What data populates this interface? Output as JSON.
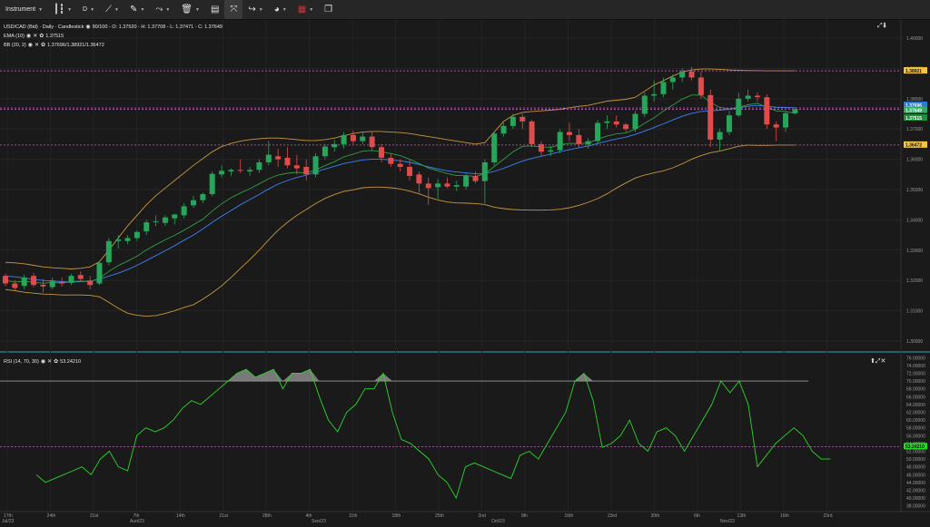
{
  "toolbar": {
    "instrument_label": "Instrument",
    "timeframe_label": "D",
    "items": [
      "candle-icon",
      "draw-line-icon",
      "pencil-icon",
      "indicators-icon",
      "trash-icon",
      "layout-icon",
      "fit-icon",
      "share-icon",
      "theme-icon",
      "flag-icon",
      "window-icon"
    ]
  },
  "legend": {
    "main": "USD/CAD (Bid) · Daily · Candlestick",
    "ohlc": "90/100 - O: 1.37520 - H: 1.37708 - L: 1.37471 - C: 1.37649",
    "ema_label": "EMA (10)",
    "ema_value": "1.37515",
    "bb_label": "BB (20, 2)",
    "bb_value": "1.37696/1.38921/1.36472",
    "rsi_label": "RSI (14, 70, 30)",
    "rsi_value": "53.24210"
  },
  "price_axis": {
    "ticks": [
      "1.40000",
      "1.39000",
      "1.38000",
      "1.37000",
      "1.36000",
      "1.35000",
      "1.34000",
      "1.33000",
      "1.32000",
      "1.31000",
      "1.30000"
    ],
    "badges": [
      {
        "label": "1.38921",
        "color": "#f5c542"
      },
      {
        "label": "1.37696",
        "color": "#2b7bd8"
      },
      {
        "label": "1.37649",
        "color": "#2eae63"
      },
      {
        "label": "1.37515",
        "color": "#1e8e3e"
      },
      {
        "label": "1.36472",
        "color": "#f5c542"
      }
    ]
  },
  "rsi_axis": {
    "ticks": [
      "76.00000",
      "74.00000",
      "72.00000",
      "70.00000",
      "68.00000",
      "66.00000",
      "64.00000",
      "62.00000",
      "60.00000",
      "58.00000",
      "56.00000",
      "54.00000",
      "52.00000",
      "50.00000",
      "48.00000",
      "46.00000",
      "44.00000",
      "42.00000",
      "40.00000",
      "38.00000"
    ],
    "badge": "53.24210"
  },
  "time_axis": {
    "days": [
      "17th",
      "24th",
      "31st",
      "7th",
      "14th",
      "21st",
      "28th",
      "4th",
      "11th",
      "18th",
      "25th",
      "2nd",
      "9th",
      "16th",
      "23rd",
      "30th",
      "6th",
      "13th",
      "16th",
      "23rd"
    ],
    "months": [
      "Jul/23",
      "Aug/23",
      "Sep/23",
      "Oct/23",
      "Nov/23"
    ]
  },
  "colors": {
    "up": "#26a65b",
    "down": "#e04b4b",
    "ema": "#2f9e44",
    "bb_mid": "#3b82f6",
    "bb_band": "#c8963e",
    "rsi": "#2bd62b"
  },
  "chart_data": {
    "type": "candlestick",
    "title": "USD/CAD (Bid) · Daily · Candlestick",
    "ylim": [
      1.297,
      1.406
    ],
    "rsi_ylim": [
      37,
      77
    ],
    "candles": [
      [
        1.3215,
        1.3222,
        1.3182,
        1.319
      ],
      [
        1.319,
        1.3201,
        1.3168,
        1.3175
      ],
      [
        1.3182,
        1.322,
        1.317,
        1.321
      ],
      [
        1.3215,
        1.3225,
        1.3178,
        1.3185
      ],
      [
        1.3186,
        1.3205,
        1.316,
        1.318
      ],
      [
        1.3178,
        1.321,
        1.317,
        1.32
      ],
      [
        1.3195,
        1.321,
        1.318,
        1.319
      ],
      [
        1.3192,
        1.3222,
        1.3185,
        1.3215
      ],
      [
        1.3218,
        1.323,
        1.3196,
        1.3205
      ],
      [
        1.32,
        1.3215,
        1.317,
        1.3185
      ],
      [
        1.319,
        1.3265,
        1.3185,
        1.3258
      ],
      [
        1.326,
        1.334,
        1.325,
        1.333
      ],
      [
        1.333,
        1.335,
        1.3305,
        1.3335
      ],
      [
        1.333,
        1.335,
        1.332,
        1.334
      ],
      [
        1.334,
        1.3365,
        1.333,
        1.336
      ],
      [
        1.3362,
        1.34,
        1.335,
        1.3392
      ],
      [
        1.3395,
        1.3415,
        1.338,
        1.3395
      ],
      [
        1.339,
        1.3415,
        1.338,
        1.3408
      ],
      [
        1.3405,
        1.342,
        1.3385,
        1.3418
      ],
      [
        1.3415,
        1.3455,
        1.3405,
        1.3445
      ],
      [
        1.3448,
        1.348,
        1.344,
        1.3465
      ],
      [
        1.3465,
        1.349,
        1.3455,
        1.3485
      ],
      [
        1.3485,
        1.356,
        1.3478,
        1.3552
      ],
      [
        1.355,
        1.358,
        1.354,
        1.3562
      ],
      [
        1.356,
        1.357,
        1.3545,
        1.3565
      ],
      [
        1.3565,
        1.36,
        1.3555,
        1.3562
      ],
      [
        1.356,
        1.3575,
        1.3545,
        1.3565
      ],
      [
        1.3565,
        1.36,
        1.3555,
        1.359
      ],
      [
        1.359,
        1.366,
        1.358,
        1.3615
      ],
      [
        1.361,
        1.3635,
        1.3575,
        1.36
      ],
      [
        1.3605,
        1.364,
        1.357,
        1.358
      ],
      [
        1.358,
        1.3615,
        1.355,
        1.357
      ],
      [
        1.3575,
        1.36,
        1.353,
        1.355
      ],
      [
        1.355,
        1.362,
        1.354,
        1.361
      ],
      [
        1.361,
        1.365,
        1.36,
        1.3642
      ],
      [
        1.364,
        1.3665,
        1.3625,
        1.365
      ],
      [
        1.365,
        1.369,
        1.3635,
        1.368
      ],
      [
        1.368,
        1.3695,
        1.365,
        1.366
      ],
      [
        1.366,
        1.369,
        1.365,
        1.3675
      ],
      [
        1.3675,
        1.369,
        1.363,
        1.364
      ],
      [
        1.364,
        1.365,
        1.359,
        1.3605
      ],
      [
        1.3605,
        1.362,
        1.3575,
        1.3585
      ],
      [
        1.3585,
        1.36,
        1.356,
        1.3575
      ],
      [
        1.3575,
        1.36,
        1.353,
        1.3545
      ],
      [
        1.355,
        1.356,
        1.349,
        1.352
      ],
      [
        1.352,
        1.354,
        1.345,
        1.3505
      ],
      [
        1.3508,
        1.3535,
        1.347,
        1.352
      ],
      [
        1.352,
        1.354,
        1.3505,
        1.351
      ],
      [
        1.351,
        1.353,
        1.3495,
        1.3515
      ],
      [
        1.351,
        1.3555,
        1.35,
        1.3545
      ],
      [
        1.3545,
        1.356,
        1.352,
        1.3528
      ],
      [
        1.3528,
        1.36,
        1.3455,
        1.359
      ],
      [
        1.359,
        1.369,
        1.358,
        1.3685
      ],
      [
        1.3685,
        1.372,
        1.3675,
        1.371
      ],
      [
        1.371,
        1.375,
        1.37,
        1.374
      ],
      [
        1.374,
        1.375,
        1.37,
        1.3725
      ],
      [
        1.3725,
        1.373,
        1.364,
        1.365
      ],
      [
        1.365,
        1.366,
        1.361,
        1.3625
      ],
      [
        1.3625,
        1.3645,
        1.361,
        1.363
      ],
      [
        1.363,
        1.37,
        1.362,
        1.369
      ],
      [
        1.369,
        1.372,
        1.366,
        1.368
      ],
      [
        1.368,
        1.37,
        1.364,
        1.365
      ],
      [
        1.365,
        1.367,
        1.3635,
        1.366
      ],
      [
        1.366,
        1.373,
        1.365,
        1.372
      ],
      [
        1.372,
        1.3745,
        1.37,
        1.3725
      ],
      [
        1.3725,
        1.3745,
        1.3705,
        1.3715
      ],
      [
        1.3715,
        1.372,
        1.369,
        1.37
      ],
      [
        1.37,
        1.376,
        1.369,
        1.375
      ],
      [
        1.375,
        1.382,
        1.374,
        1.381
      ],
      [
        1.381,
        1.386,
        1.379,
        1.3815
      ],
      [
        1.3815,
        1.387,
        1.3805,
        1.3855
      ],
      [
        1.3855,
        1.388,
        1.383,
        1.387
      ],
      [
        1.387,
        1.39,
        1.3855,
        1.389
      ],
      [
        1.389,
        1.3905,
        1.386,
        1.387
      ],
      [
        1.387,
        1.389,
        1.38,
        1.3812
      ],
      [
        1.3812,
        1.383,
        1.364,
        1.3665
      ],
      [
        1.3665,
        1.37,
        1.363,
        1.369
      ],
      [
        1.369,
        1.376,
        1.368,
        1.3745
      ],
      [
        1.3745,
        1.382,
        1.374,
        1.38
      ],
      [
        1.38,
        1.383,
        1.379,
        1.381
      ],
      [
        1.381,
        1.382,
        1.379,
        1.3805
      ],
      [
        1.3805,
        1.3815,
        1.37,
        1.3715
      ],
      [
        1.3715,
        1.3725,
        1.366,
        1.3705
      ],
      [
        1.3705,
        1.376,
        1.369,
        1.3752
      ],
      [
        1.3752,
        1.3771,
        1.3747,
        1.3765
      ]
    ],
    "ema10": [
      1.32,
      1.3195,
      1.3197,
      1.3194,
      1.3191,
      1.3193,
      1.3192,
      1.3196,
      1.3198,
      1.3196,
      1.3207,
      1.323,
      1.3249,
      1.3264,
      1.328,
      1.3301,
      1.3318,
      1.3334,
      1.3349,
      1.3366,
      1.3384,
      1.3402,
      1.3429,
      1.3453,
      1.3473,
      1.3489,
      1.3503,
      1.3519,
      1.3536,
      1.3548,
      1.3554,
      1.3557,
      1.3555,
      1.3565,
      1.3579,
      1.3592,
      1.3608,
      1.3617,
      1.3627,
      1.3629,
      1.3625,
      1.3619,
      1.3612,
      1.36,
      1.3586,
      1.3571,
      1.3562,
      1.3553,
      1.3546,
      1.3546,
      1.3543,
      1.3552,
      1.3576,
      1.36,
      1.3625,
      1.3643,
      1.3644,
      1.3641,
      1.3639,
      1.3648,
      1.3653,
      1.3652,
      1.3654,
      1.3666,
      1.3677,
      1.3684,
      1.3687,
      1.3699,
      1.3719,
      1.3737,
      1.3759,
      1.3779,
      1.3799,
      1.3812,
      1.3812,
      1.3788,
      1.3771,
      1.3766,
      1.3772,
      1.378,
      1.3785,
      1.3772,
      1.376,
      1.3758,
      1.3752
    ],
    "bb_mid": [
      1.3215,
      1.3212,
      1.3208,
      1.3204,
      1.32,
      1.3198,
      1.3196,
      1.3195,
      1.3196,
      1.3198,
      1.3204,
      1.3214,
      1.3224,
      1.3236,
      1.325,
      1.3266,
      1.3282,
      1.3298,
      1.3315,
      1.3333,
      1.335,
      1.337,
      1.3392,
      1.3412,
      1.3431,
      1.345,
      1.3467,
      1.3484,
      1.3502,
      1.3518,
      1.353,
      1.354,
      1.3548,
      1.3558,
      1.3568,
      1.3577,
      1.3586,
      1.3592,
      1.3598,
      1.36,
      1.36,
      1.3598,
      1.3595,
      1.359,
      1.3583,
      1.3575,
      1.3568,
      1.3562,
      1.3558,
      1.3555,
      1.3552,
      1.3553,
      1.356,
      1.357,
      1.3582,
      1.3594,
      1.3603,
      1.361,
      1.3617,
      1.3625,
      1.3632,
      1.3638,
      1.3644,
      1.3652,
      1.366,
      1.3667,
      1.3673,
      1.3682,
      1.3693,
      1.3705,
      1.3717,
      1.373,
      1.3742,
      1.3752,
      1.3758,
      1.376,
      1.3762,
      1.3765,
      1.377,
      1.3775,
      1.3778,
      1.3775,
      1.3772,
      1.3771,
      1.377
    ],
    "bb_upper": [
      1.326,
      1.3258,
      1.3255,
      1.325,
      1.3245,
      1.3242,
      1.324,
      1.3238,
      1.324,
      1.3245,
      1.3262,
      1.33,
      1.334,
      1.338,
      1.3415,
      1.345,
      1.348,
      1.3505,
      1.353,
      1.3555,
      1.358,
      1.3602,
      1.3625,
      1.3642,
      1.3652,
      1.366,
      1.3665,
      1.3668,
      1.367,
      1.367,
      1.3668,
      1.3665,
      1.3662,
      1.3662,
      1.3665,
      1.367,
      1.3678,
      1.3685,
      1.369,
      1.3692,
      1.3692,
      1.369,
      1.3688,
      1.3685,
      1.368,
      1.3675,
      1.367,
      1.3665,
      1.366,
      1.3655,
      1.365,
      1.3655,
      1.369,
      1.3725,
      1.3745,
      1.3755,
      1.3758,
      1.376,
      1.3762,
      1.3765,
      1.377,
      1.3775,
      1.3778,
      1.3785,
      1.3792,
      1.3795,
      1.3798,
      1.3805,
      1.3825,
      1.3845,
      1.386,
      1.3875,
      1.3888,
      1.3895,
      1.3898,
      1.3898,
      1.3897,
      1.3895,
      1.3894,
      1.3893,
      1.3893,
      1.3892,
      1.3892,
      1.3892,
      1.3892
    ],
    "bb_lower": [
      1.317,
      1.3166,
      1.3161,
      1.3158,
      1.3155,
      1.3154,
      1.3152,
      1.3152,
      1.3152,
      1.3151,
      1.3146,
      1.3128,
      1.3108,
      1.3092,
      1.3085,
      1.3082,
      1.3084,
      1.3091,
      1.31,
      1.3111,
      1.312,
      1.3138,
      1.3159,
      1.3182,
      1.321,
      1.324,
      1.3269,
      1.33,
      1.3334,
      1.3366,
      1.3392,
      1.3415,
      1.3434,
      1.3454,
      1.3471,
      1.3484,
      1.3494,
      1.3499,
      1.3506,
      1.3508,
      1.3508,
      1.3506,
      1.3502,
      1.3495,
      1.3486,
      1.3475,
      1.3466,
      1.3459,
      1.3456,
      1.3455,
      1.3454,
      1.3451,
      1.3442,
      1.3437,
      1.3434,
      1.3433,
      1.3432,
      1.3432,
      1.3433,
      1.3435,
      1.344,
      1.3448,
      1.3458,
      1.347,
      1.3486,
      1.3505,
      1.3522,
      1.3538,
      1.3548,
      1.3555,
      1.3562,
      1.3572,
      1.3585,
      1.36,
      1.3612,
      1.3622,
      1.3627,
      1.3635,
      1.3643,
      1.3647,
      1.3646,
      1.3646,
      1.3647,
      1.3647,
      1.3647
    ],
    "rsi": [
      46,
      44,
      45,
      46,
      47,
      48,
      46,
      50,
      52,
      48,
      47,
      56,
      58,
      57,
      58,
      60,
      63,
      65,
      64,
      66,
      68,
      70,
      72,
      73,
      71,
      72,
      73,
      68,
      72,
      72,
      73,
      66,
      60,
      57,
      62,
      64,
      68,
      68,
      72,
      62,
      55,
      54,
      52,
      50,
      46,
      44,
      40,
      48,
      49,
      48,
      47,
      46,
      45,
      51,
      52,
      50,
      54,
      58,
      62,
      70,
      72,
      65,
      53,
      54,
      56,
      60,
      54,
      52,
      57,
      58,
      56,
      52,
      56,
      60,
      64,
      70,
      67,
      70,
      64,
      48,
      51,
      54,
      56,
      58,
      56,
      52,
      50,
      50
    ],
    "levels": {
      "bb_upper_line": 1.38921,
      "ema_line": 1.37696,
      "bb_lower_line": 1.36472,
      "rsi_overbought": 70,
      "rsi_level": 53.2
    }
  }
}
